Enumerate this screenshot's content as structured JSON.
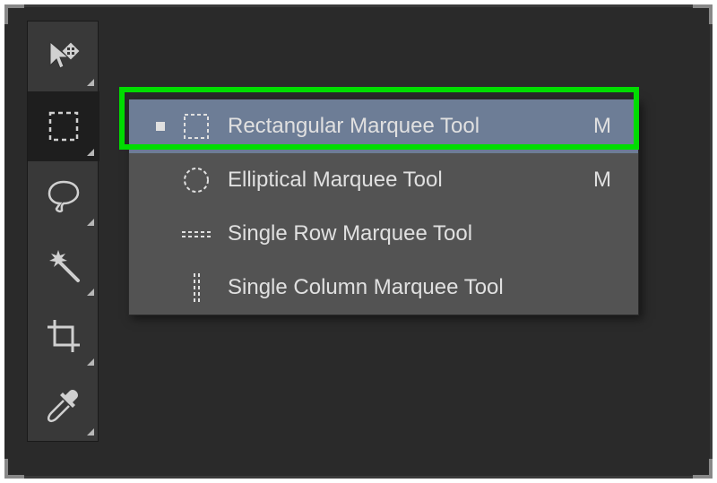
{
  "toolbar": {
    "tools": [
      {
        "name": "move-tool",
        "iconName": "move-icon"
      },
      {
        "name": "marquee-tool",
        "iconName": "rect-marquee-icon",
        "active": true
      },
      {
        "name": "lasso-tool",
        "iconName": "lasso-icon"
      },
      {
        "name": "magic-wand-tool",
        "iconName": "magic-wand-icon"
      },
      {
        "name": "crop-tool",
        "iconName": "crop-icon"
      },
      {
        "name": "eyedropper-tool",
        "iconName": "eyedropper-icon"
      }
    ]
  },
  "flyout": {
    "items": [
      {
        "label": "Rectangular Marquee Tool",
        "shortcut": "M",
        "selected": true,
        "iconName": "rect-marquee-icon"
      },
      {
        "label": "Elliptical Marquee Tool",
        "shortcut": "M",
        "selected": false,
        "iconName": "elliptical-marquee-icon"
      },
      {
        "label": "Single Row Marquee Tool",
        "shortcut": "",
        "selected": false,
        "iconName": "single-row-marquee-icon"
      },
      {
        "label": "Single Column Marquee Tool",
        "shortcut": "",
        "selected": false,
        "iconName": "single-column-marquee-icon"
      }
    ]
  },
  "colors": {
    "highlight": "#00dd00",
    "panelBg": "#393939",
    "flyoutBg": "#535353",
    "selectedBg": "#6d7d96",
    "iconColor": "#d0d0d0"
  }
}
